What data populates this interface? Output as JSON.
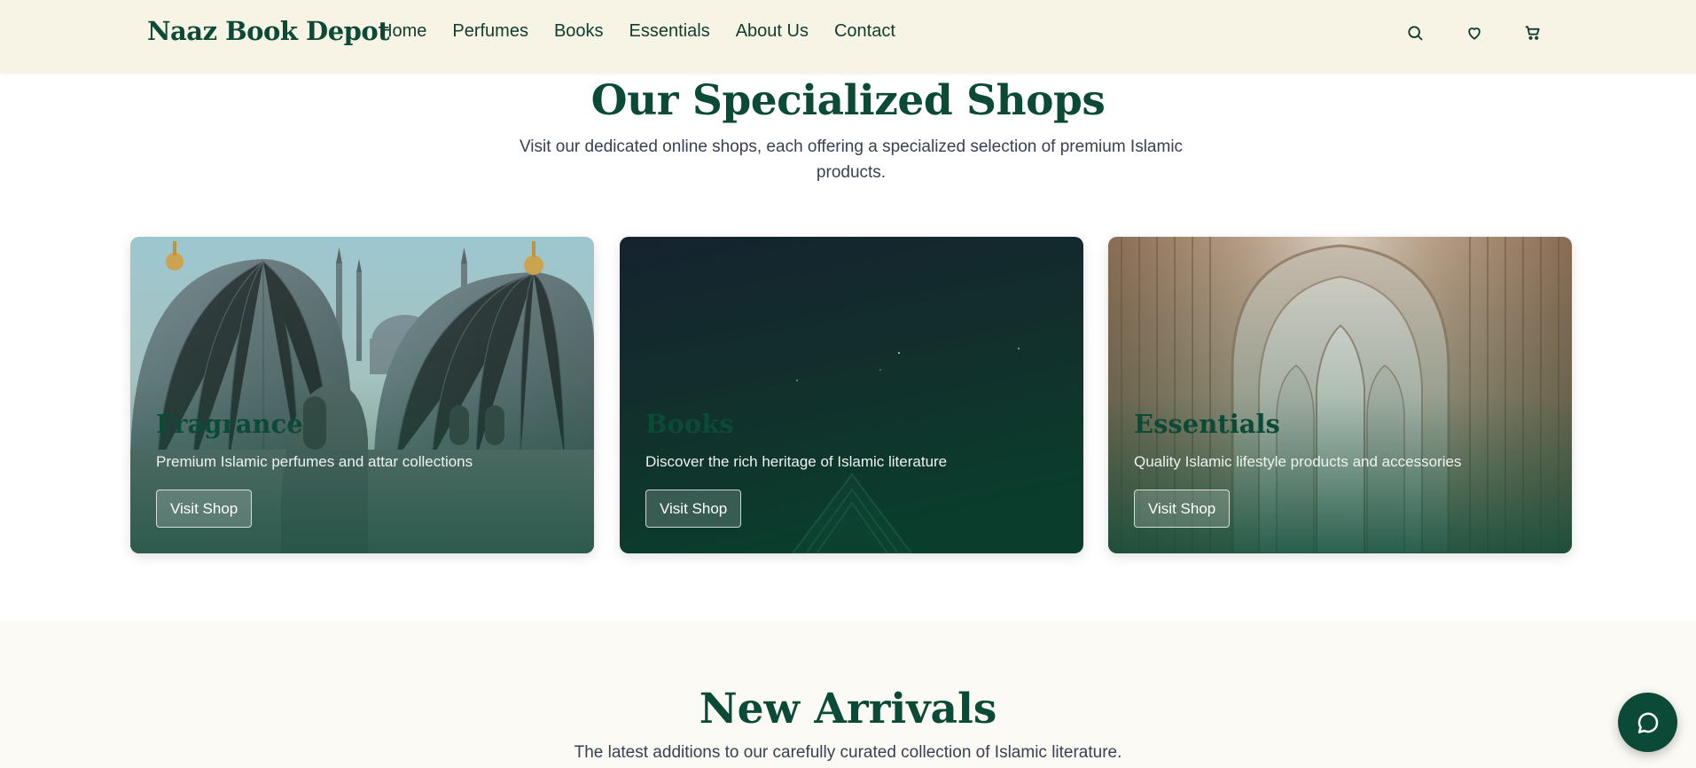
{
  "header": {
    "logo": "Naaz Book Depot",
    "nav": [
      "Home",
      "Perfumes",
      "Books",
      "Essentials",
      "About Us",
      "Contact"
    ],
    "icons": [
      "search-icon",
      "heart-icon",
      "cart-icon"
    ]
  },
  "shops_section": {
    "title": "Our Specialized Shops",
    "subtitle": "Visit our dedicated online shops, each offering a specialized selection of premium Islamic products.",
    "cards": [
      {
        "title": "Fragrance",
        "description": "Premium Islamic perfumes and attar collections",
        "button": "Visit Shop"
      },
      {
        "title": "Books",
        "description": "Discover the rich heritage of Islamic literature",
        "button": "Visit Shop"
      },
      {
        "title": "Essentials",
        "description": "Quality Islamic lifestyle products and accessories",
        "button": "Visit Shop"
      }
    ]
  },
  "arrivals_section": {
    "title": "New Arrivals",
    "subtitle": "The latest additions to our carefully curated collection of Islamic literature."
  },
  "colors": {
    "brand_green": "#0b4a37",
    "header_bg": "#f7f3e5",
    "section_bg": "#fcfaf5"
  }
}
